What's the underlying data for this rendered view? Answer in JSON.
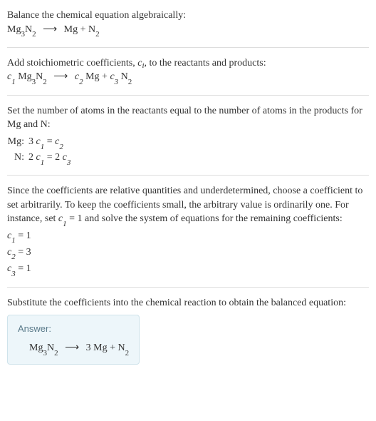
{
  "chart_data": {
    "type": "table",
    "title": "Balance chemical equation algebraically",
    "reaction_unbalanced": "Mg3N2 -> Mg + N2",
    "coefficients_template": "c1 Mg3N2 -> c2 Mg + c3 N2",
    "atom_balance": [
      {
        "element": "Mg",
        "equation": "3 c1 = c2"
      },
      {
        "element": "N",
        "equation": "2 c1 = 2 c3"
      }
    ],
    "fixed": "c1 = 1",
    "solution": {
      "c1": 1,
      "c2": 3,
      "c3": 1
    },
    "balanced": "Mg3N2 -> 3 Mg + N2"
  },
  "step1": {
    "line1": "Balance the chemical equation algebraically:",
    "eq_lhs": "Mg",
    "eq_lhs_sub1": "3",
    "eq_lhs_n": "N",
    "eq_lhs_sub2": "2",
    "arrow": "⟶",
    "eq_rhs1": "Mg + N",
    "eq_rhs1_sub": "2"
  },
  "step2": {
    "text_a": "Add stoichiometric coefficients, ",
    "ci": "c",
    "ci_sub": "i",
    "text_b": ", to the reactants and products:",
    "c1": "c",
    "s1": "1",
    "sp1": " Mg",
    "sp1s1": "3",
    "sp1n": "N",
    "sp1s2": "2",
    "arrow": "⟶",
    "c2": "c",
    "s2": "2",
    "sp2": " Mg + ",
    "c3": "c",
    "s3": "3",
    "sp3": " N",
    "sp3s": "2"
  },
  "step3": {
    "intro": "Set the number of atoms in the reactants equal to the number of atoms in the products for Mg and N:",
    "rows": [
      {
        "el": "Mg:",
        "lhs_n": "3 ",
        "lhs_c": "c",
        "lhs_s": "1",
        "eq": " = ",
        "rhs_c": "c",
        "rhs_s": "2",
        "rhs_pre": "",
        "rhs_post": ""
      },
      {
        "el": "N:",
        "lhs_n": "2 ",
        "lhs_c": "c",
        "lhs_s": "1",
        "eq": " = ",
        "rhs_pre": "2 ",
        "rhs_c": "c",
        "rhs_s": "3",
        "rhs_post": ""
      }
    ]
  },
  "step4": {
    "intro_a": "Since the coefficients are relative quantities and underdetermined, choose a coefficient to set arbitrarily. To keep the coefficients small, the arbitrary value is ordinarily one. For instance, set ",
    "c": "c",
    "cs": "1",
    "intro_b": " = 1 and solve the system of equations for the remaining coefficients:",
    "sol": [
      {
        "c": "c",
        "s": "1",
        "v": " = 1"
      },
      {
        "c": "c",
        "s": "2",
        "v": " = 3"
      },
      {
        "c": "c",
        "s": "3",
        "v": " = 1"
      }
    ]
  },
  "step5": {
    "text": "Substitute the coefficients into the chemical reaction to obtain the balanced equation:",
    "answer_label": "Answer:",
    "lhs": "Mg",
    "lhs_s1": "3",
    "lhs_n": "N",
    "lhs_s2": "2",
    "arrow": "⟶",
    "rhs": " 3 Mg + N",
    "rhs_s": "2"
  }
}
